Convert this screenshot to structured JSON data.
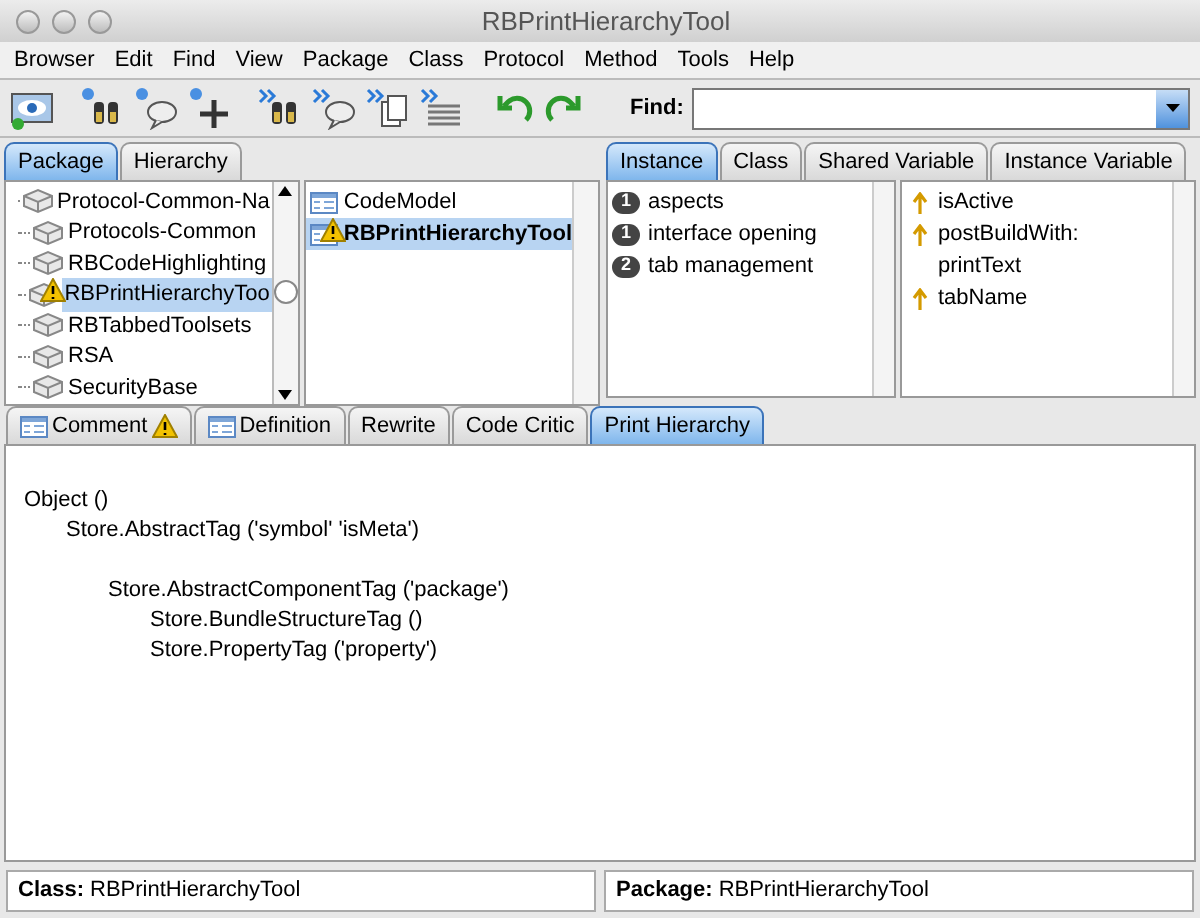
{
  "window": {
    "title": "RBPrintHierarchyTool"
  },
  "menu": [
    "Browser",
    "Edit",
    "Find",
    "View",
    "Package",
    "Class",
    "Protocol",
    "Method",
    "Tools",
    "Help"
  ],
  "toolbar": [
    {
      "kind": "eye"
    },
    {
      "kind": "binoculars"
    },
    {
      "kind": "bubble"
    },
    {
      "kind": "plus"
    },
    {
      "kind": "binoculars2"
    },
    {
      "kind": "bubble2"
    },
    {
      "kind": "docs"
    },
    {
      "kind": "lines"
    },
    {
      "kind": "undo"
    },
    {
      "kind": "redo"
    }
  ],
  "find": {
    "label": "Find:"
  },
  "package_tabs": [
    {
      "label": "Package",
      "selected": true
    },
    {
      "label": "Hierarchy",
      "selected": false
    }
  ],
  "packages": [
    {
      "label": "Protocol-Common-Na",
      "selected": false,
      "warning": false
    },
    {
      "label": "Protocols-Common",
      "selected": false,
      "warning": false
    },
    {
      "label": "RBCodeHighlighting",
      "selected": false,
      "warning": false
    },
    {
      "label": "RBPrintHierarchyToo",
      "selected": true,
      "warning": true
    },
    {
      "label": "RBTabbedToolsets",
      "selected": false,
      "warning": false
    },
    {
      "label": "RSA",
      "selected": false,
      "warning": false
    },
    {
      "label": "SecurityBase",
      "selected": false,
      "warning": false
    }
  ],
  "classes": [
    {
      "label": "CodeModel",
      "selected": false,
      "warning": false
    },
    {
      "label": "RBPrintHierarchyTool",
      "selected": true,
      "warning": true
    }
  ],
  "protocol_tabs": [
    {
      "label": "Instance",
      "selected": true
    },
    {
      "label": "Class",
      "selected": false
    },
    {
      "label": "Shared Variable",
      "selected": false
    },
    {
      "label": "Instance Variable",
      "selected": false
    }
  ],
  "protocols": [
    {
      "count": "1",
      "label": "aspects"
    },
    {
      "count": "1",
      "label": "interface opening"
    },
    {
      "count": "2",
      "label": "tab management"
    }
  ],
  "methods": [
    {
      "label": "isActive",
      "arrow": true
    },
    {
      "label": "postBuildWith:",
      "arrow": true
    },
    {
      "label": "printText",
      "arrow": false
    },
    {
      "label": "tabName",
      "arrow": true
    }
  ],
  "editor_tabs": [
    {
      "label": "Comment",
      "kind": "doc",
      "warning": true,
      "selected": false
    },
    {
      "label": "Definition",
      "kind": "doc",
      "warning": false,
      "selected": false
    },
    {
      "label": "Rewrite",
      "kind": "plain",
      "warning": false,
      "selected": false
    },
    {
      "label": "Code Critic",
      "kind": "plain",
      "warning": false,
      "selected": false
    },
    {
      "label": "Print Hierarchy",
      "kind": "plain",
      "warning": false,
      "selected": true
    }
  ],
  "hierarchy": [
    {
      "text": "Object ()",
      "blank_before": false,
      "children": [
        {
          "text": "Store.AbstractTag ('symbol' 'isMeta')",
          "blank_before": false,
          "children": [
            {
              "text": "Store.AbstractComponentTag ('package')",
              "blank_before": true,
              "children": [
                {
                  "text": "Store.BundleStructureTag ()",
                  "blank_before": false
                },
                {
                  "text": "Store.PropertyTag ('property')",
                  "blank_before": false
                }
              ]
            }
          ]
        }
      ]
    }
  ],
  "status_bar": [
    {
      "label": "Class:",
      "value": "RBPrintHierarchyTool"
    },
    {
      "label": "Package:",
      "value": "RBPrintHierarchyTool"
    }
  ]
}
